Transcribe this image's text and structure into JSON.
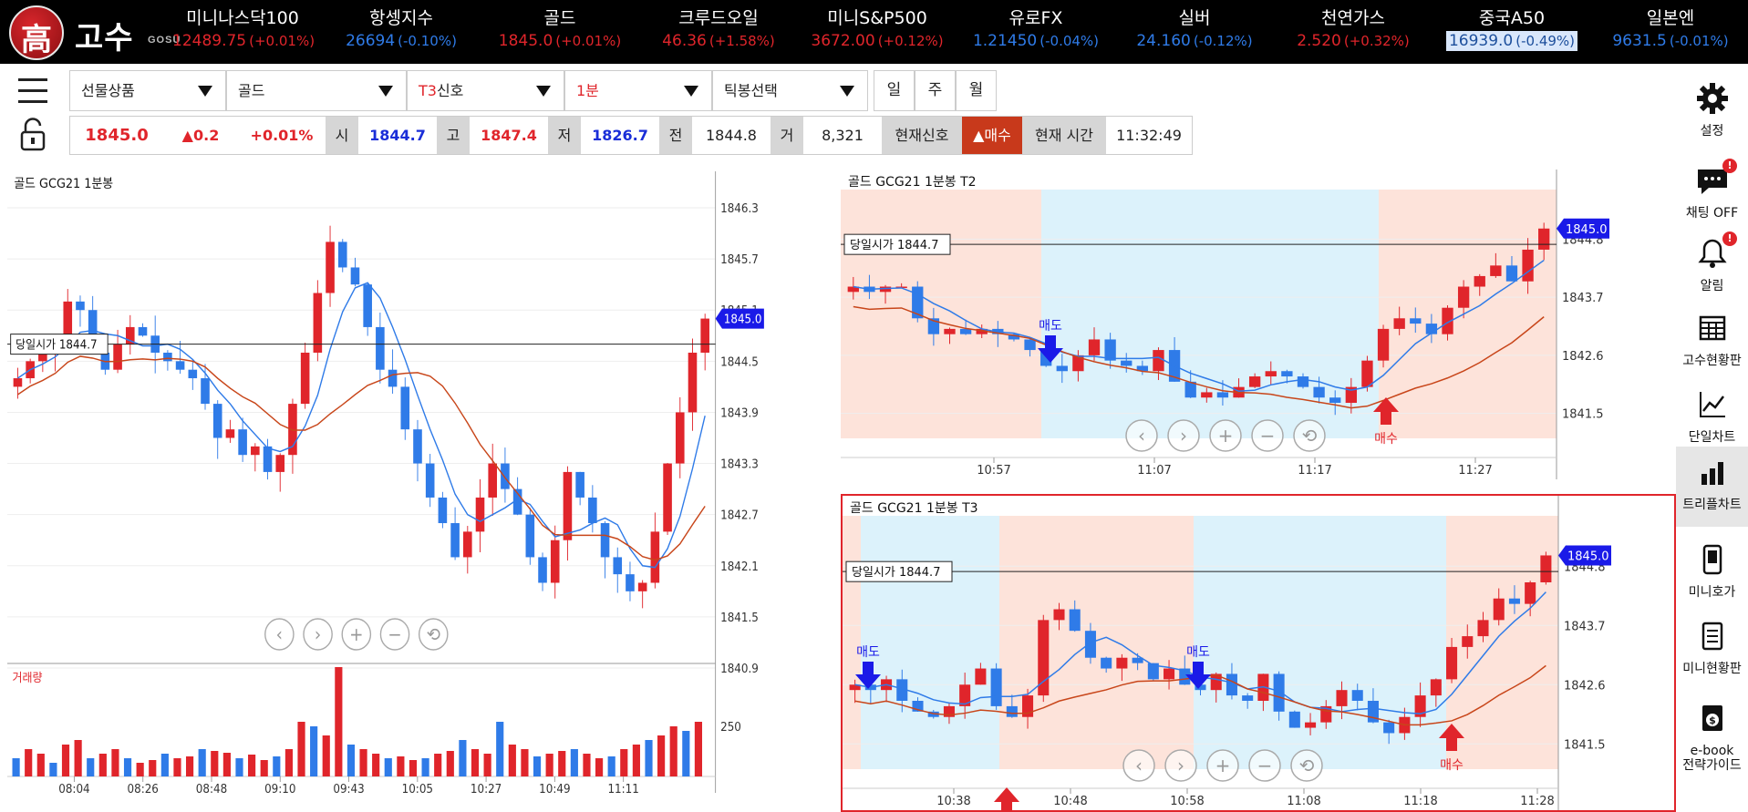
{
  "logo": {
    "seal": "高",
    "name_kr": "고수",
    "name_en": "GOSU"
  },
  "ticker": [
    {
      "name": "미니나스닥100",
      "value": "12489.75",
      "change": "(+0.01%)",
      "dir": "up",
      "highlight": false
    },
    {
      "name": "항셍지수",
      "value": "26694",
      "change": "(-0.10%)",
      "dir": "dn",
      "highlight": false
    },
    {
      "name": "골드",
      "value": "1845.0",
      "change": "(+0.01%)",
      "dir": "up",
      "highlight": false
    },
    {
      "name": "크루드오일",
      "value": "46.36",
      "change": "(+1.58%)",
      "dir": "up",
      "highlight": false
    },
    {
      "name": "미니S&P500",
      "value": "3672.00",
      "change": "(+0.12%)",
      "dir": "up",
      "highlight": false
    },
    {
      "name": "유로FX",
      "value": "1.21450",
      "change": "(-0.04%)",
      "dir": "dn",
      "highlight": false
    },
    {
      "name": "실버",
      "value": "24.160",
      "change": "(-0.12%)",
      "dir": "dn",
      "highlight": false
    },
    {
      "name": "천연가스",
      "value": "2.520",
      "change": "(+0.32%)",
      "dir": "up",
      "highlight": false
    },
    {
      "name": "중국A50",
      "value": "16939.0",
      "change": "(-0.49%)",
      "dir": "dn",
      "highlight": true
    },
    {
      "name": "일본엔",
      "value": "9631.5",
      "change": "(-0.01%)",
      "dir": "dn",
      "highlight": false
    }
  ],
  "selectors": [
    {
      "label": "선물상품",
      "red": false
    },
    {
      "label": "골드",
      "red": false
    },
    {
      "label_red": "T3",
      "label": "신호",
      "red": true
    },
    {
      "label": "1분",
      "red": true
    },
    {
      "label": "틱봉선택",
      "red": false
    }
  ],
  "period_buttons": [
    "일",
    "주",
    "월"
  ],
  "price_row": {
    "price": "1845.0",
    "change": "▲0.2",
    "change_pct": "+0.01%",
    "open_label": "시",
    "open": "1844.7",
    "high_label": "고",
    "high": "1847.4",
    "low_label": "저",
    "low": "1826.7",
    "prev_label": "전",
    "prev": "1844.8",
    "vol_label": "거",
    "vol": "8,321",
    "signal_label": "현재신호",
    "signal": "▲매수",
    "time_label": "현재 시간",
    "time": "11:32:49"
  },
  "sidebar": [
    {
      "label": "설정",
      "icon": "gear-icon"
    },
    {
      "label": "채팅 OFF",
      "icon": "chat-icon",
      "badge": "!"
    },
    {
      "label": "알림",
      "icon": "bell-icon",
      "badge": "!"
    },
    {
      "label": "고수현황판",
      "icon": "grid-icon"
    },
    {
      "label": "단일차트",
      "icon": "line-chart-icon"
    },
    {
      "label": "트리플차트",
      "icon": "bar-chart-icon",
      "active": true
    },
    {
      "label": "미니호가",
      "icon": "phone-icon"
    },
    {
      "label": "미니현황판",
      "icon": "clipboard-icon"
    },
    {
      "label": "e-book\n전략가이드",
      "icon": "ebook-icon"
    }
  ],
  "chart_data": [
    {
      "type": "candlestick",
      "title": "골드 GCG21 1분봉",
      "volume_label": "거래량",
      "volume_tick": "250",
      "open_price_label": "당일시가 1844.7",
      "open_price": 1844.7,
      "current_price": "1845.0",
      "y_ticks": [
        "1846.3",
        "1845.7",
        "1845.1",
        "1844.5",
        "1843.9",
        "1843.3",
        "1842.7",
        "1842.1",
        "1841.5",
        "1840.9"
      ],
      "x_ticks": [
        "08:04",
        "08:26",
        "08:48",
        "09:10",
        "09:43",
        "10:05",
        "10:27",
        "10:49",
        "11:11"
      ],
      "ylim": [
        1840.9,
        1846.3
      ],
      "close_series": [
        1844.3,
        1844.5,
        1844.6,
        1844.8,
        1845.2,
        1845.1,
        1844.6,
        1844.4,
        1844.7,
        1844.9,
        1844.8,
        1844.6,
        1844.5,
        1844.4,
        1844.3,
        1844.0,
        1843.6,
        1843.7,
        1843.4,
        1843.5,
        1843.2,
        1843.4,
        1844.0,
        1844.6,
        1845.3,
        1845.9,
        1845.6,
        1845.4,
        1844.9,
        1844.4,
        1844.2,
        1843.7,
        1843.3,
        1842.9,
        1842.6,
        1842.2,
        1842.5,
        1842.9,
        1843.3,
        1843.0,
        1842.7,
        1842.2,
        1841.9,
        1842.4,
        1843.2,
        1842.9,
        1842.6,
        1842.2,
        1842.0,
        1841.8,
        1841.9,
        1842.5,
        1843.3,
        1843.9,
        1844.6,
        1845.0
      ],
      "volumes": [
        20,
        30,
        25,
        15,
        35,
        40,
        20,
        25,
        30,
        20,
        15,
        18,
        25,
        20,
        22,
        30,
        28,
        26,
        20,
        24,
        18,
        22,
        30,
        60,
        55,
        45,
        120,
        35,
        30,
        25,
        20,
        22,
        18,
        20,
        25,
        28,
        40,
        30,
        25,
        60,
        35,
        30,
        22,
        25,
        28,
        30,
        25,
        20,
        22,
        30,
        35,
        40,
        45,
        55,
        50,
        60
      ]
    },
    {
      "type": "candlestick",
      "title": "골드 GCG21 1분봉 T2",
      "open_price_label": "당일시가 1844.7",
      "current_price": "1845.0",
      "y_ticks": [
        "1844.8",
        "1843.7",
        "1842.6",
        "1841.5"
      ],
      "x_ticks": [
        "10:57",
        "11:07",
        "11:17",
        "11:27"
      ],
      "ylim": [
        1841.2,
        1845.6
      ],
      "sell_label": "매도",
      "buy_label": "매수",
      "close_series": [
        1843.9,
        1843.8,
        1843.9,
        1843.9,
        1843.3,
        1843.0,
        1843.1,
        1843.0,
        1843.1,
        1843.0,
        1842.9,
        1842.7,
        1842.4,
        1842.3,
        1842.6,
        1842.9,
        1842.5,
        1842.4,
        1842.3,
        1842.7,
        1842.1,
        1841.8,
        1841.9,
        1841.8,
        1842.0,
        1842.2,
        1842.3,
        1842.2,
        1842.0,
        1841.8,
        1841.7,
        1842.0,
        1842.5,
        1843.1,
        1843.3,
        1843.2,
        1843.0,
        1843.5,
        1843.9,
        1844.1,
        1844.3,
        1844.0,
        1844.6,
        1845.0
      ]
    },
    {
      "type": "candlestick",
      "title": "골드 GCG21 1분봉 T3",
      "open_price_label": "당일시가 1844.7",
      "current_price": "1845.0",
      "y_ticks": [
        "1844.8",
        "1843.7",
        "1842.6",
        "1841.5"
      ],
      "x_ticks": [
        "10:38",
        "10:48",
        "10:58",
        "11:08",
        "11:18",
        "11:28"
      ],
      "ylim": [
        1841.2,
        1845.6
      ],
      "sell_label": "매도",
      "buy_label": "매수",
      "close_series": [
        1842.6,
        1842.5,
        1842.7,
        1842.3,
        1842.1,
        1842.0,
        1842.2,
        1842.6,
        1842.9,
        1842.2,
        1842.0,
        1842.4,
        1843.8,
        1844.0,
        1843.6,
        1843.1,
        1842.9,
        1843.1,
        1843.0,
        1842.7,
        1842.9,
        1842.6,
        1842.5,
        1842.8,
        1842.4,
        1842.3,
        1842.8,
        1842.1,
        1841.8,
        1841.9,
        1842.2,
        1842.5,
        1842.3,
        1841.9,
        1841.7,
        1842.0,
        1842.4,
        1842.7,
        1843.3,
        1843.5,
        1843.8,
        1844.2,
        1844.1,
        1844.5,
        1845.0
      ]
    }
  ],
  "colors": {
    "up": "#e0252b",
    "down": "#2f7be8",
    "ma_fast": "#2f7be8",
    "ma_slow": "#c8461a",
    "zone_buy": "#fde3da",
    "zone_sell": "#dcf2fb"
  }
}
